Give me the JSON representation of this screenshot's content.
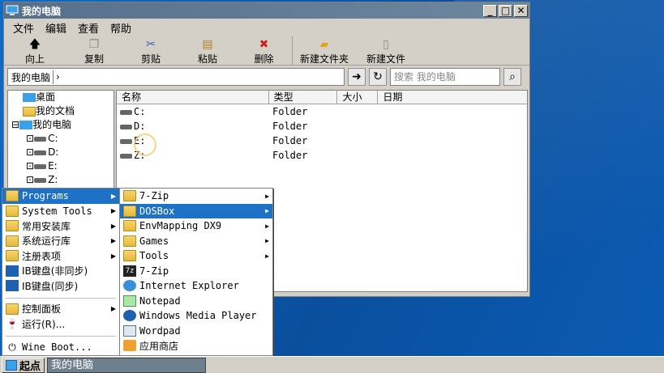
{
  "window": {
    "title": "我的电脑",
    "menu": [
      "文件",
      "编辑",
      "查看",
      "帮助"
    ],
    "toolbar": [
      {
        "label": "向上",
        "icon": "up-arrow-icon"
      },
      {
        "label": "复制",
        "icon": "copy-icon"
      },
      {
        "label": "剪贴",
        "icon": "cut-icon"
      },
      {
        "label": "粘贴",
        "icon": "paste-icon"
      },
      {
        "label": "删除",
        "icon": "delete-icon"
      },
      {
        "label": "新建文件夹",
        "icon": "new-folder-icon"
      },
      {
        "label": "新建文件",
        "icon": "new-file-icon"
      }
    ],
    "address": "我的电脑",
    "search_placeholder": "搜索 我的电脑",
    "tree": [
      "桌面",
      "我的文档",
      "我的电脑",
      "C:",
      "D:",
      "E:",
      "Z:"
    ],
    "columns": [
      "名称",
      "类型",
      "大小",
      "日期"
    ],
    "files": [
      {
        "name": "C:",
        "type": "Folder"
      },
      {
        "name": "D:",
        "type": "Folder"
      },
      {
        "name": "E:",
        "type": "Folder"
      },
      {
        "name": "Z:",
        "type": "Folder"
      }
    ]
  },
  "start_menu": {
    "items": [
      "Programs",
      "System Tools",
      "常用安装库",
      "系统运行库",
      "注册表项",
      "IB键盘(非同步)",
      "IB键盘(同步)"
    ],
    "bottom": [
      "控制面板",
      "运行(R)...",
      "Wine Boot..."
    ]
  },
  "programs_menu": {
    "items": [
      "7-Zip",
      "DOSBox",
      "EnvMapping DX9",
      "Games",
      "Tools",
      "7-Zip",
      "Internet Explorer",
      "Notepad",
      "Windows Media Player",
      "Wordpad",
      "应用商店"
    ]
  },
  "taskbar": {
    "start": "起点",
    "task": "我的电脑"
  },
  "colors": {
    "accent": "#1d72c7",
    "titlebar": "#5f7890"
  }
}
